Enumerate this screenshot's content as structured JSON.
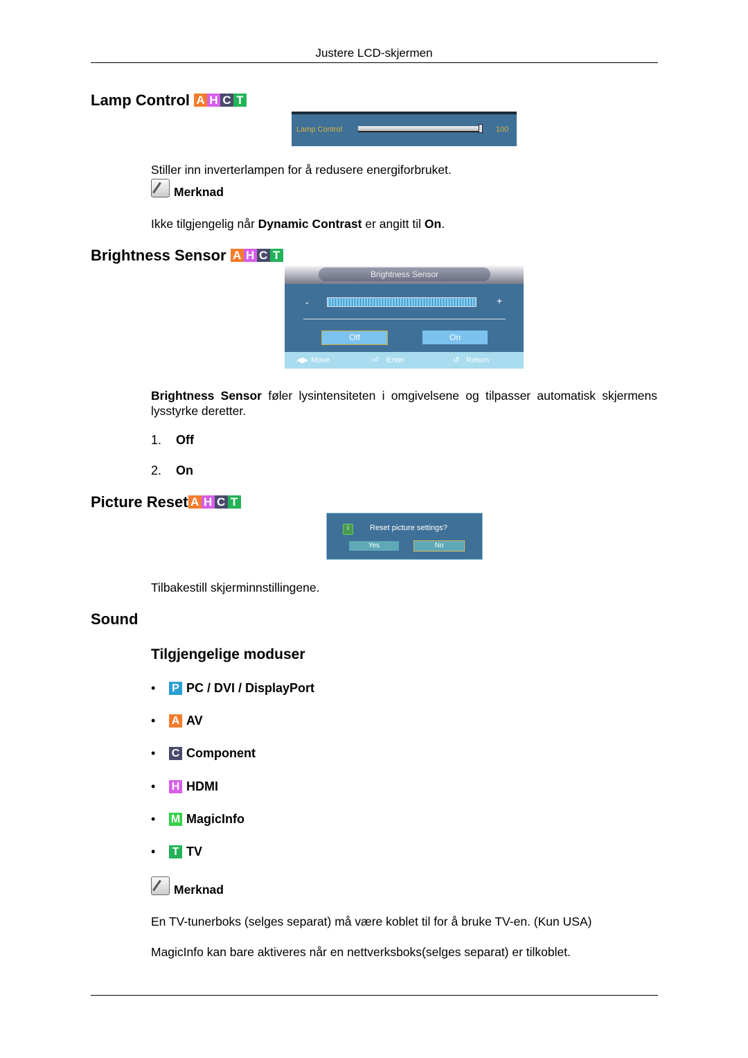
{
  "header": {
    "title": "Justere LCD-skjermen"
  },
  "badge_colors": {
    "A": "#f47c2c",
    "H": "#d65ee8",
    "C": "#4a4b6c",
    "T": "#22b358",
    "P": "#2a9fd6",
    "M": "#34d04a"
  },
  "lamp": {
    "title": "Lamp Control",
    "badges": [
      "A",
      "H",
      "C",
      "T"
    ],
    "osd_label": "Lamp Control",
    "osd_value": "100",
    "slider_percent": 100,
    "desc": "Stiller inn inverterlampen for å redusere energiforbruket.",
    "note_label": "Merknad",
    "note_pre": "Ikke tilgjengelig når ",
    "note_b1": "Dynamic Contrast",
    "note_mid": " er angitt til ",
    "note_b2": "On",
    "note_end": "."
  },
  "brightness": {
    "title": "Brightness Sensor",
    "badges": [
      "A",
      "H",
      "C",
      "T"
    ],
    "osd_title": "Brightness Sensor",
    "minus": "-",
    "plus": "+",
    "off": "Off",
    "on": "On",
    "move": "Move",
    "enter": "Enter",
    "return": "Return",
    "desc_b": "Brightness Sensor",
    "desc": " føler lysintensiteten i omgivelsene og tilpasser automatisk skjermens lysstyrke deretter.",
    "options": [
      {
        "num": "1.",
        "label": "Off"
      },
      {
        "num": "2.",
        "label": "On"
      }
    ]
  },
  "reset": {
    "title": "Picture Reset",
    "badges": [
      "A",
      "H",
      "C",
      "T"
    ],
    "question": "Reset picture settings?",
    "yes": "Yes",
    "no": "No",
    "desc": "Tilbakestill skjerminnstillingene."
  },
  "sound": {
    "title": "Sound",
    "modes_title": "Tilgjengelige moduser",
    "modes": [
      {
        "badge": "P",
        "label": "PC / DVI / DisplayPort"
      },
      {
        "badge": "A",
        "label": "AV"
      },
      {
        "badge": "C",
        "label": "Component"
      },
      {
        "badge": "H",
        "label": "HDMI"
      },
      {
        "badge": "M",
        "label": "MagicInfo"
      },
      {
        "badge": "T",
        "label": "TV"
      }
    ],
    "note_label": "Merknad",
    "note1": "En TV-tunerboks (selges separat) må være koblet til for å bruke TV-en. (Kun USA)",
    "note2": "MagicInfo kan bare aktiveres når en nettverksboks(selges separat) er tilkoblet."
  }
}
